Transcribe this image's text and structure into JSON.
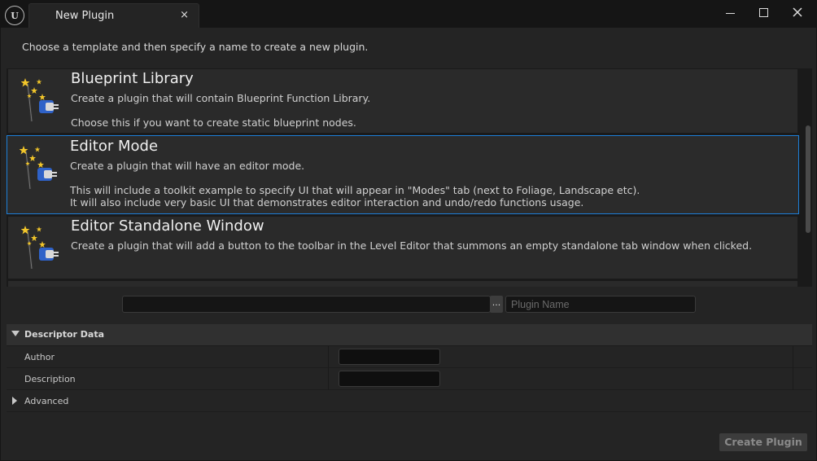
{
  "window": {
    "logo": "U",
    "tab_title": "New Plugin",
    "tab_close": "×"
  },
  "instruction": "Choose a template and then specify a name to create a new plugin.",
  "templates": [
    {
      "title": "Blueprint Library",
      "description": "Create a plugin that will contain Blueprint Function Library.",
      "extra": "Choose this if you want to create static blueprint nodes.",
      "icon": "plugin-wand-icon",
      "selected": false
    },
    {
      "title": "Editor Mode",
      "description": "Create a plugin that will have an editor mode.",
      "extra": "This will include a toolkit example to specify UI that will appear in \"Modes\" tab (next to Foliage, Landscape etc).\nIt will also include very basic UI that demonstrates editor interaction and undo/redo functions usage.",
      "icon": "plugin-wand-icon",
      "selected": true
    },
    {
      "title": "Editor Standalone Window",
      "description": "Create a plugin that will add a button to the toolbar in the Level Editor that summons an empty standalone tab window when clicked.",
      "extra": "",
      "icon": "plugin-wand-icon",
      "selected": false
    }
  ],
  "path": {
    "value": "",
    "browse_label": "..."
  },
  "plugin_name": {
    "placeholder": "Plugin Name",
    "value": ""
  },
  "descriptor": {
    "header": "Descriptor Data",
    "rows": [
      {
        "label": "Author",
        "value": ""
      },
      {
        "label": "Description",
        "value": ""
      }
    ],
    "advanced_label": "Advanced"
  },
  "create_button": "Create Plugin",
  "colors": {
    "selection_border": "#1d7fd8",
    "background": "#242424"
  }
}
